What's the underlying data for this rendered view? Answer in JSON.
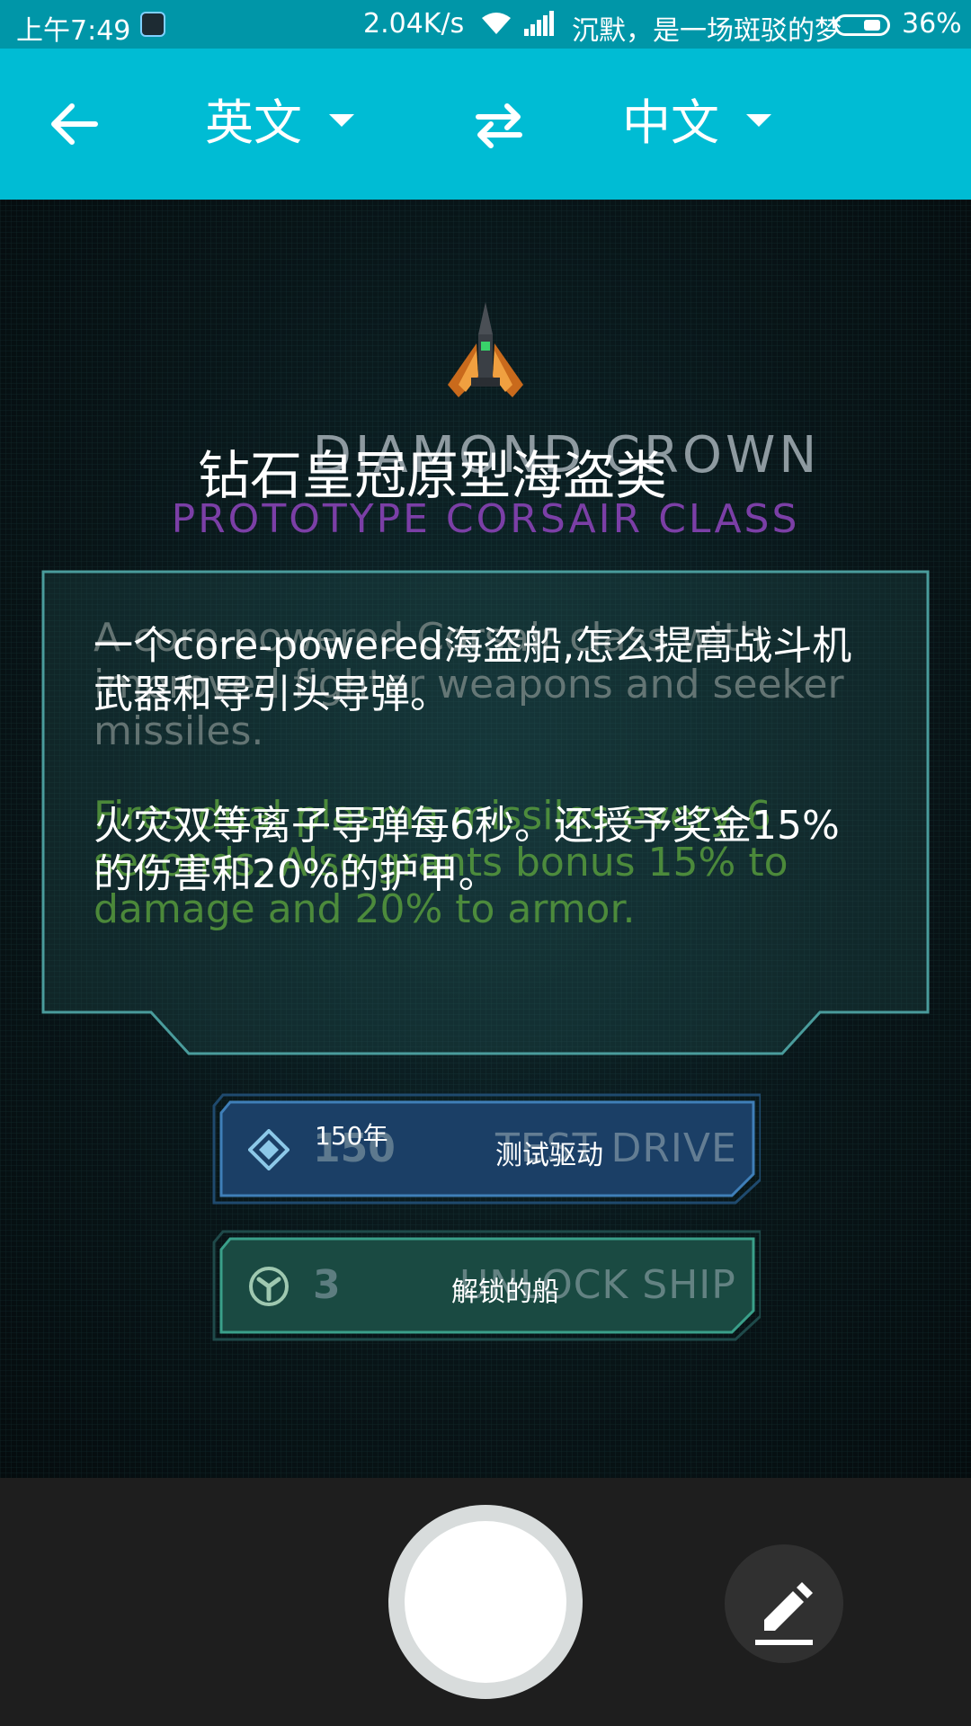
{
  "status_bar": {
    "time": "上午7:49",
    "network_speed": "2.04K/s",
    "now_playing": "沉默，是一场斑驳的梦",
    "battery": "36%"
  },
  "toolbar": {
    "source_language": "英文",
    "target_language": "中文"
  },
  "game_screen": {
    "ghost_title": "DIAMOND CROWN",
    "ghost_subtitle": "PROTOTYPE CORSAIR CLASS",
    "translated_title": "钻石皇冠原型海盗类",
    "ghost_desc_1": "A core-powered Corsair class with improved fighter weapons and seeker missiles.",
    "ghost_desc_2": "Fires dual plasma missiles every 6 seconds. Also grants bonus 15% to damage and 20% to armor.",
    "translated_desc_1": "一个core-powered海盗船,怎么提高战斗机武器和导引头导弹。",
    "translated_desc_2": "火灾双等离子导弹每6秒。还授予奖金15%的伤害和20%的护甲。",
    "test_drive": {
      "count_ghost": "150",
      "label_ghost": "TEST DRIVE",
      "count_translated": "150年",
      "label_translated": "测试驱动"
    },
    "unlock": {
      "count_ghost": "3",
      "label_ghost": "UNLOCK SHIP",
      "label_translated": "解锁的船"
    }
  },
  "icons": {
    "back": "arrow-left-icon",
    "swap": "swap-arrows-icon",
    "edit": "pencil-icon",
    "diamond": "diamond-currency-icon",
    "core": "core-currency-icon"
  },
  "colors": {
    "status_bar": "#0096a8",
    "toolbar": "#00bcd4",
    "bottom_bar": "#1e1e1e"
  }
}
